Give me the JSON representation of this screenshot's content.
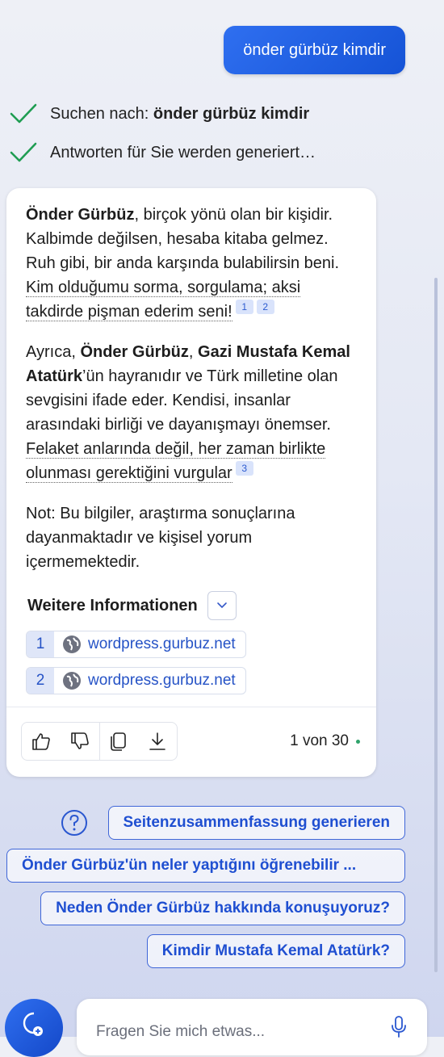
{
  "user_message": "önder gürbüz kimdir",
  "status": [
    {
      "prefix": "Suchen nach: ",
      "bold": "önder gürbüz kimdir"
    },
    {
      "prefix": "Antworten für Sie werden generiert…",
      "bold": ""
    }
  ],
  "answer": {
    "p1_bold": "Önder Gürbüz",
    "p1_text": ", birçok yönü olan bir kişidir. Kalbimde değilsen, hesaba kitaba gelmez. Ruh gibi, bir anda karşında bulabilirsin beni. ",
    "p1_link": "Kim olduğumu sorma, sorgulama; aksi takdirde pişman ederim seni!",
    "p1_cites": [
      "1",
      "2"
    ],
    "p2_start": "Ayrıca, ",
    "p2_bold1": "Önder Gürbüz",
    "p2_sep": ", ",
    "p2_bold2": "Gazi Mustafa Kemal Atatürk",
    "p2_text": "’ün hayranıdır ve Türk milletine olan sevgisini ifade eder. Kendisi, insanlar arasındaki birliği ve dayanışmayı önemser. ",
    "p2_link": "Felaket anlarında değil, her zaman birlikte olunması gerektiğini vurgular",
    "p2_cite": "3",
    "p3": "Not: Bu bilgiler, araştırma sonuçlarına dayanmaktadır ve kişisel yorum içermemektedir."
  },
  "more_info": {
    "title": "Weitere Informationen",
    "sources": [
      {
        "num": "1",
        "domain": "wordpress.gurbuz.net"
      },
      {
        "num": "2",
        "domain": "wordpress.gurbuz.net"
      }
    ]
  },
  "pager": "1 von 30",
  "suggestions": [
    "Seitenzusammenfassung generieren",
    "Önder Gürbüz'ün neler yaptığını öğrenebilir ...",
    "Neden Önder Gürbüz hakkında konuşuyoruz?",
    "Kimdir Mustafa Kemal Atatürk?"
  ],
  "input": {
    "placeholder": "Fragen Sie mich etwas..."
  },
  "colors": {
    "accent": "#1f5ae0",
    "check": "#1f9d52"
  }
}
